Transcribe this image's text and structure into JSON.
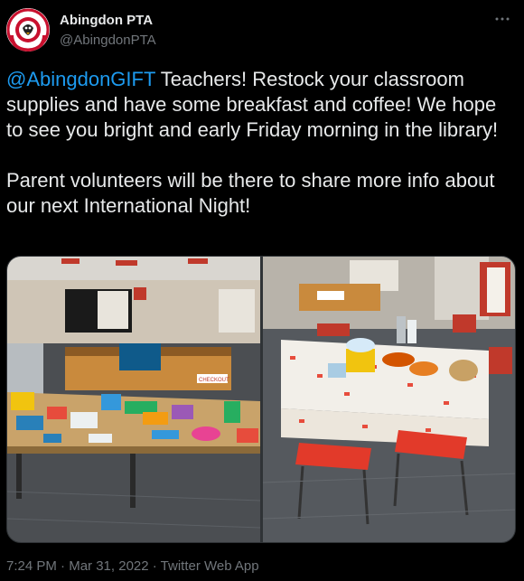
{
  "account": {
    "display_name": "Abingdon PTA",
    "handle": "@AbingdonPTA",
    "avatar_icon": "abingdon-elementary-seal",
    "avatar_text_top": "ABINGDON",
    "avatar_text_bottom": "ELEMENTARY",
    "more_icon": "more-options-icon"
  },
  "tweet": {
    "mention": "@AbingdonGIFT",
    "text_line1": " Teachers! Restock your classroom supplies and have some breakfast and coffee! We hope to see you bright and early Friday morning in the library!",
    "text_para2": "Parent volunteers will be there to share more info about our next International Night!"
  },
  "media": {
    "left_photo_desc_icon": "library-supply-table-photo",
    "right_photo_desc_icon": "breakfast-table-photo",
    "checkout_sign": "CHECKOUT"
  },
  "meta": {
    "time": "7:24 PM",
    "separator": " · ",
    "date": "Mar 31, 2022",
    "source": "Twitter Web App"
  },
  "colors": {
    "background": "#000000",
    "text": "#e7e9ea",
    "secondary": "#71767b",
    "link": "#1d9bf0"
  }
}
